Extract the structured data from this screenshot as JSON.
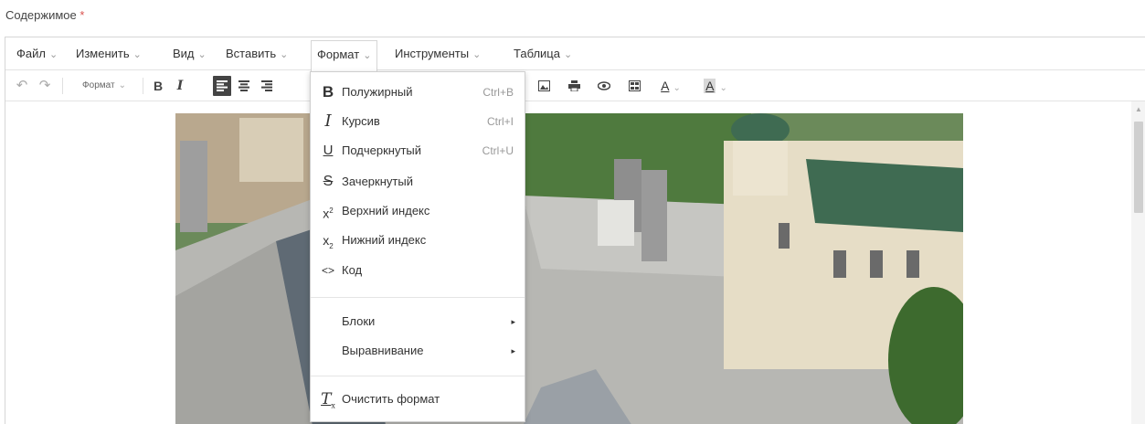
{
  "field": {
    "label": "Содержимое",
    "required_mark": "*"
  },
  "menubar": {
    "items": [
      {
        "label": "Файл"
      },
      {
        "label": "Изменить"
      },
      {
        "label": "Вид"
      },
      {
        "label": "Вставить"
      },
      {
        "label": "Формат"
      },
      {
        "label": "Инструменты"
      },
      {
        "label": "Таблица"
      }
    ],
    "caret": "⌄",
    "active": "Формат"
  },
  "toolbar": {
    "undo": "↶",
    "redo": "↷",
    "format_select": "Формат",
    "bold": "B",
    "italic": "I",
    "text_color": "A",
    "bg_color": "A"
  },
  "format_menu": {
    "items": [
      {
        "icon": "bold-icon",
        "glyph": "B",
        "label": "Полужирный",
        "shortcut": "Ctrl+B"
      },
      {
        "icon": "italic-icon",
        "glyph": "I",
        "label": "Курсив",
        "shortcut": "Ctrl+I"
      },
      {
        "icon": "underline-icon",
        "glyph": "U",
        "label": "Подчеркнутый",
        "shortcut": "Ctrl+U"
      },
      {
        "icon": "strikethrough-icon",
        "glyph": "S",
        "label": "Зачеркнутый",
        "shortcut": ""
      },
      {
        "icon": "superscript-icon",
        "glyph": "x",
        "label": "Верхний индекс",
        "shortcut": ""
      },
      {
        "icon": "subscript-icon",
        "glyph": "x",
        "label": "Нижний индекс",
        "shortcut": ""
      },
      {
        "icon": "code-icon",
        "glyph": "<>",
        "label": "Код",
        "shortcut": ""
      }
    ],
    "submenus": [
      {
        "label": "Блоки"
      },
      {
        "label": "Выравнивание"
      }
    ],
    "clear": {
      "icon": "clear-format-icon",
      "glyph": "T",
      "label": "Очистить формат"
    }
  },
  "colors": {
    "required": "#d9534f",
    "menu_text": "#333333",
    "shortcut": "#999999",
    "roof": "#a8a8a8",
    "roof_green": "#2e6b4f"
  }
}
